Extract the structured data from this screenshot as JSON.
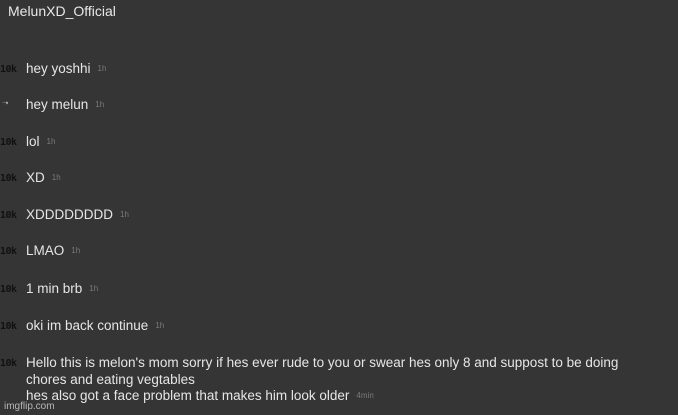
{
  "channel": {
    "title": "MelunXD_Official"
  },
  "messages": [
    {
      "avatar": "10k",
      "text": "hey yoshhi",
      "time": "1h"
    },
    {
      "avatar": "arrow-icon",
      "text": "hey melun",
      "time": "1h"
    },
    {
      "avatar": "10k",
      "text": "lol",
      "time": "1h"
    },
    {
      "avatar": "10k",
      "text": "XD",
      "time": "1h"
    },
    {
      "avatar": "10k",
      "text": "XDDDDDDDD",
      "time": "1h"
    },
    {
      "avatar": "10k",
      "text": "LMAO",
      "time": "1h"
    },
    {
      "avatar": "10k",
      "text": "1 min brb",
      "time": "1h"
    },
    {
      "avatar": "10k",
      "text": "oki im back continue",
      "time": "1h"
    },
    {
      "avatar": "10k",
      "lines": [
        "Hello this is melon's mom sorry if hes ever rude to you or swear hes only 8 and suppost to be doing",
        "chores and eating vegtables",
        "hes also got a face problem that makes him look older"
      ],
      "time": "4min"
    }
  ],
  "watermark": "imgflip.com"
}
